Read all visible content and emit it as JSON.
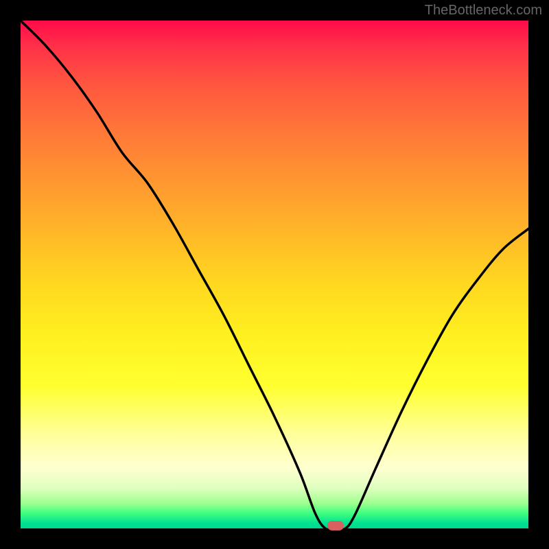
{
  "watermark": "TheBottleneck.com",
  "chart_data": {
    "type": "line",
    "title": "",
    "xlabel": "",
    "ylabel": "",
    "xlim": [
      0,
      100
    ],
    "ylim": [
      0,
      100
    ],
    "x": [
      0,
      5,
      10,
      15,
      20,
      25,
      30,
      35,
      40,
      45,
      50,
      55,
      58,
      60,
      62,
      64,
      66,
      70,
      75,
      80,
      85,
      90,
      95,
      100
    ],
    "values": [
      100,
      95,
      89,
      82,
      74,
      68,
      60,
      51,
      42,
      32,
      22,
      11,
      3,
      0,
      0,
      0,
      3,
      12,
      23,
      33,
      42,
      49,
      55,
      59
    ],
    "marker": {
      "x": 62,
      "y": 0
    },
    "background_gradient": {
      "top": "#ff0a4a",
      "bottom": "#00d890",
      "description": "red to green vertical gradient"
    }
  },
  "colors": {
    "curve": "#000000",
    "marker": "#d86060",
    "background": "#000000"
  }
}
